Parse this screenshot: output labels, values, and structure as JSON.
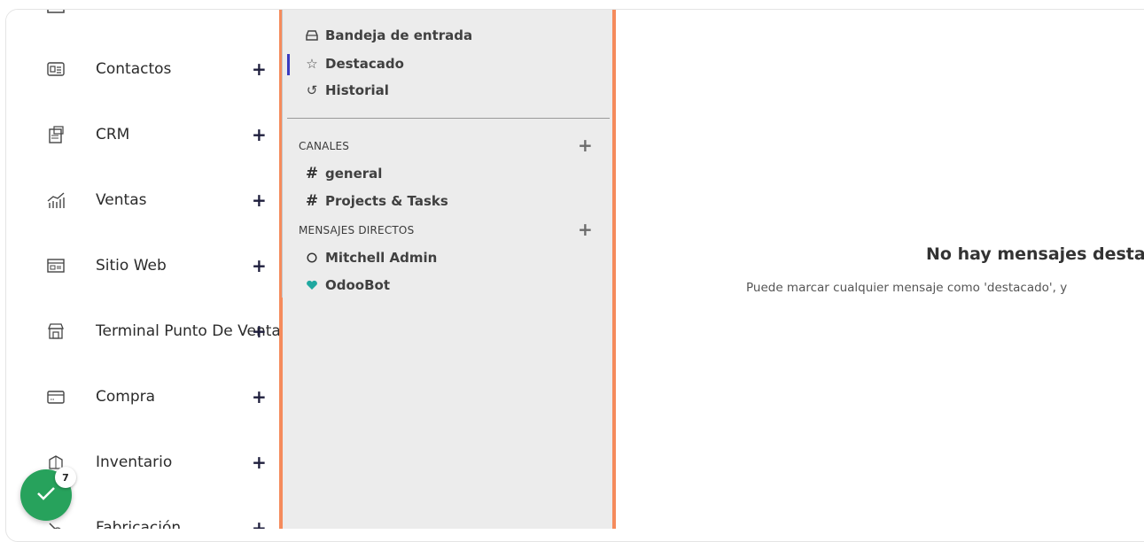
{
  "apps": [
    {
      "label": "Contactos",
      "icon": "contacts-icon"
    },
    {
      "label": "CRM",
      "icon": "crm-icon"
    },
    {
      "label": "Ventas",
      "icon": "sales-chart-icon"
    },
    {
      "label": "Sitio Web",
      "icon": "website-icon"
    },
    {
      "label": "Terminal Punto De Venta",
      "icon": "shop-icon"
    },
    {
      "label": "Compra",
      "icon": "credit-card-icon"
    },
    {
      "label": "Inventario",
      "icon": "inventory-box-icon"
    },
    {
      "label": "Fabricación",
      "icon": "manufacturing-icon"
    }
  ],
  "app_plus": "+",
  "mailboxes": [
    {
      "label": "Bandeja de entrada",
      "icon": "inbox-icon"
    },
    {
      "label": "Destacado",
      "icon": "star-icon"
    },
    {
      "label": "Historial",
      "icon": "history-icon"
    }
  ],
  "channels_header": "CANALES",
  "channels": [
    {
      "label": "general",
      "icon": "hash-icon"
    },
    {
      "label": "Projects & Tasks",
      "icon": "hash-icon"
    }
  ],
  "direct_header": "MENSAJES DIRECTOS",
  "direct_messages": [
    {
      "label": "Mitchell Admin",
      "icon": "status-circle-icon"
    },
    {
      "label": "OdooBot",
      "icon": "heart-icon"
    }
  ],
  "empty_state": {
    "title": "No hay mensajes destaca",
    "text": "Puede marcar cualquier mensaje como 'destacado', y"
  },
  "badge": {
    "count": "7"
  },
  "colors": {
    "accent_border": "#f58b5c",
    "active_bar": "#3b3bbf",
    "fab": "#27a25c",
    "heart": "#1fa8a0"
  }
}
